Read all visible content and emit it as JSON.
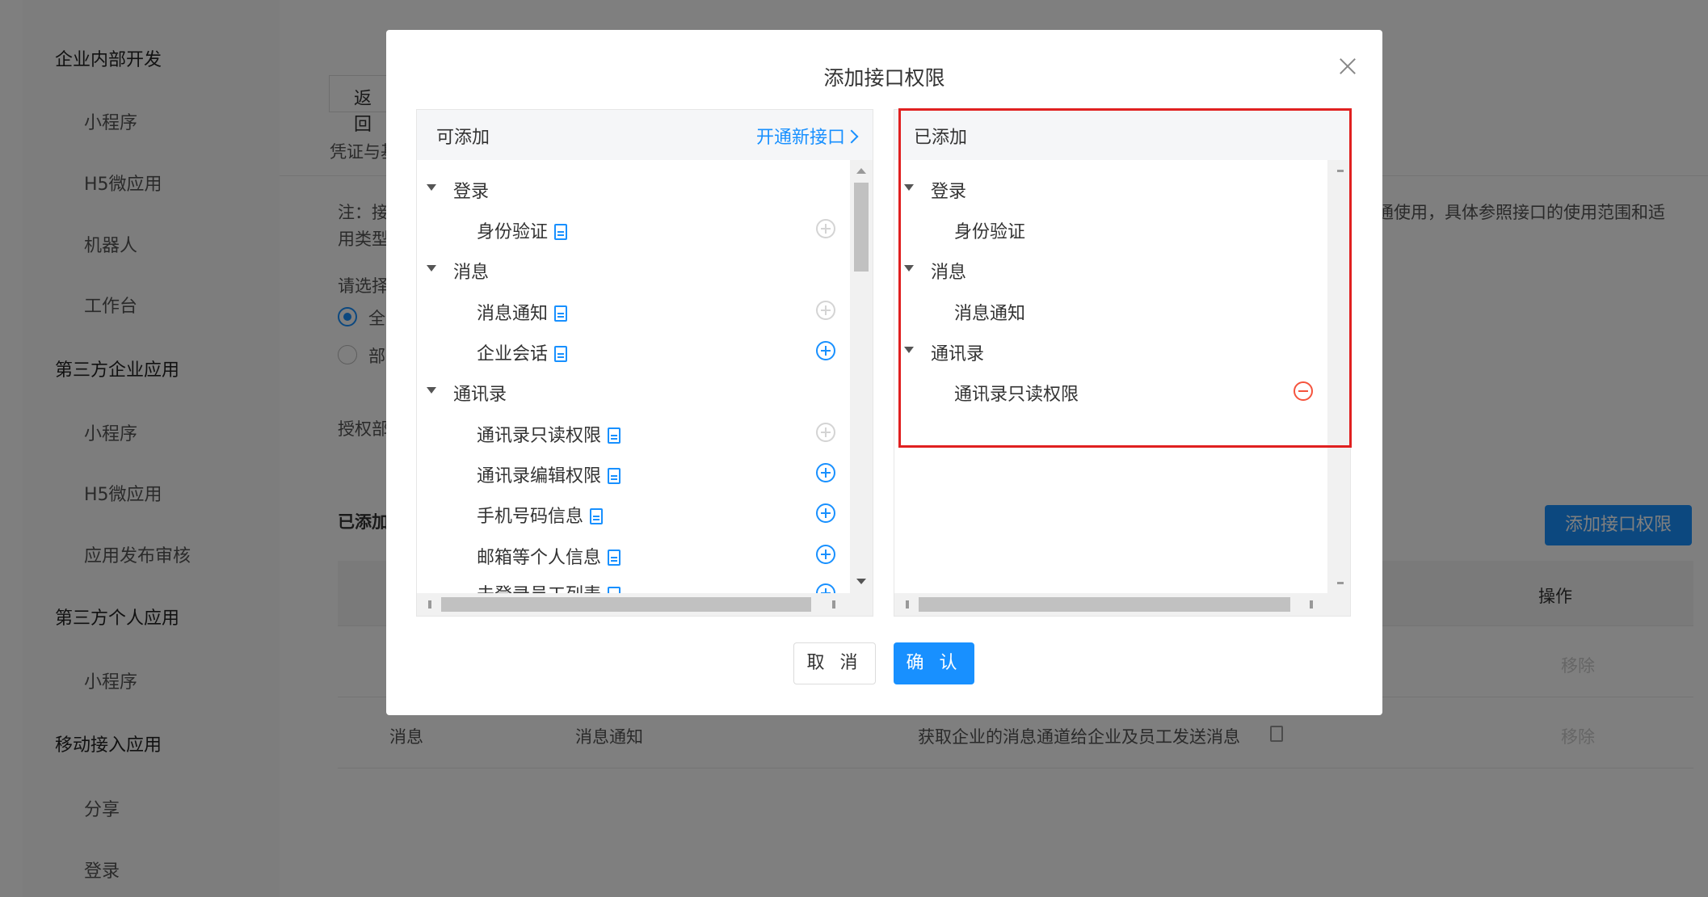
{
  "sidebar": {
    "groups": [
      {
        "label": "企业内部开发",
        "items": [
          "小程序",
          "H5微应用",
          "机器人",
          "工作台"
        ]
      },
      {
        "label": "第三方企业应用",
        "items": [
          "小程序",
          "H5微应用",
          "应用发布审核"
        ]
      },
      {
        "label": "第三方个人应用",
        "items": [
          "小程序"
        ]
      },
      {
        "label": "移动接入应用",
        "items": [
          "分享",
          "登录"
        ]
      }
    ]
  },
  "background": {
    "back_button": "返 回",
    "tab_partial": "凭证与基",
    "note_line1": "注：接",
    "note_line2": "用类型",
    "note_right": "通使用，具体参照接口的使用范围和适",
    "select_prompt": "请选择",
    "radio_all": "全",
    "radio_part": "部",
    "auth_label": "授权部",
    "added_label": "已添加",
    "add_permission_button": "添加接口权限",
    "table_col_action": "操作",
    "row1_action": "移除",
    "row2": {
      "category": "消息",
      "name": "消息通知",
      "desc": "获取企业的消息通道给企业及员工发送消息",
      "action": "移除"
    }
  },
  "modal": {
    "title": "添加接口权限",
    "left_panel": {
      "title": "可添加",
      "link": "开通新接口",
      "tree": [
        {
          "label": "登录",
          "children": [
            {
              "label": "身份验证",
              "addable": false
            }
          ]
        },
        {
          "label": "消息",
          "children": [
            {
              "label": "消息通知",
              "addable": false
            },
            {
              "label": "企业会话",
              "addable": true
            }
          ]
        },
        {
          "label": "通讯录",
          "children": [
            {
              "label": "通讯录只读权限",
              "addable": false
            },
            {
              "label": "通讯录编辑权限",
              "addable": true
            },
            {
              "label": "手机号码信息",
              "addable": true
            },
            {
              "label": "邮箱等个人信息",
              "addable": true
            },
            {
              "label": "未登录员工列表",
              "addable": true
            }
          ]
        }
      ]
    },
    "right_panel": {
      "title": "已添加",
      "tree": [
        {
          "label": "登录",
          "children": [
            {
              "label": "身份验证",
              "removable": false
            }
          ]
        },
        {
          "label": "消息",
          "children": [
            {
              "label": "消息通知",
              "removable": false
            }
          ]
        },
        {
          "label": "通讯录",
          "children": [
            {
              "label": "通讯录只读权限",
              "removable": true
            }
          ]
        }
      ]
    },
    "cancel_button": "取 消",
    "ok_button": "确 认"
  },
  "colors": {
    "accent": "#1890ff",
    "remove": "#f5533d",
    "highlight": "#e02020"
  }
}
